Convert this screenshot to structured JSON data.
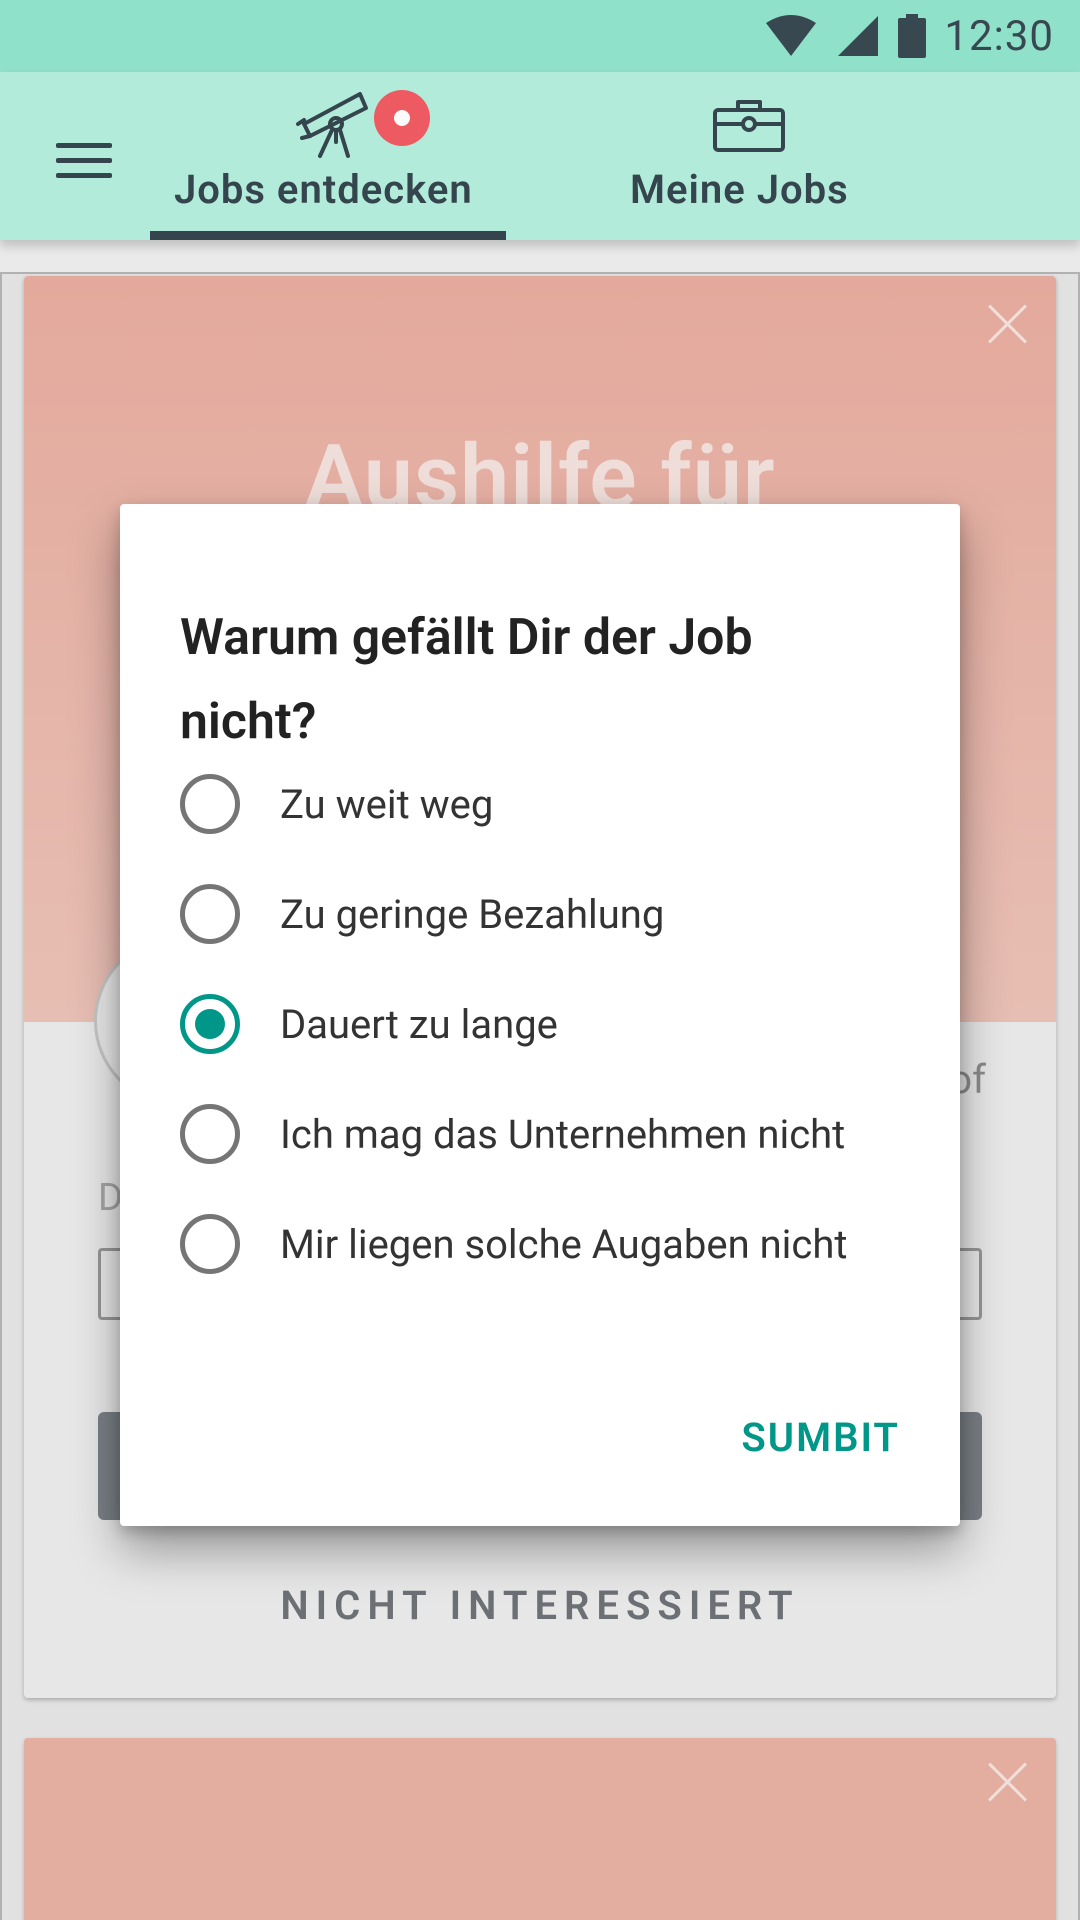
{
  "status_bar": {
    "time": "12:30",
    "icons": [
      "wifi-icon",
      "signal-icon",
      "battery-icon"
    ],
    "background": "#93e6cf"
  },
  "app_bar": {
    "background": "#b7f0df",
    "tabs": [
      {
        "label": "Jobs entdecken",
        "icon": "telescope-icon",
        "selected": true,
        "has_badge": true
      },
      {
        "label": "Meine Jobs",
        "icon": "briefcase-icon",
        "selected": false
      }
    ],
    "badge_color": "#f25c63"
  },
  "job_card": {
    "title": "Aushilfe für",
    "snippet": "of",
    "field_label": "D",
    "reject_label": "NICHT INTERESSIERT",
    "hero_color": "#e8ada0"
  },
  "dialog": {
    "title": "Warum gefällt Dir der Job nicht?",
    "options": [
      {
        "label": "Zu weit weg",
        "checked": false
      },
      {
        "label": "Zu geringe Bezahlung",
        "checked": false
      },
      {
        "label": "Dauert zu lange",
        "checked": true
      },
      {
        "label": "Ich mag das Unternehmen nicht",
        "checked": false
      },
      {
        "label": "Mir liegen solche Augaben nicht",
        "checked": false
      }
    ],
    "submit_label": "SUMBIT",
    "accent_color": "#009688"
  }
}
